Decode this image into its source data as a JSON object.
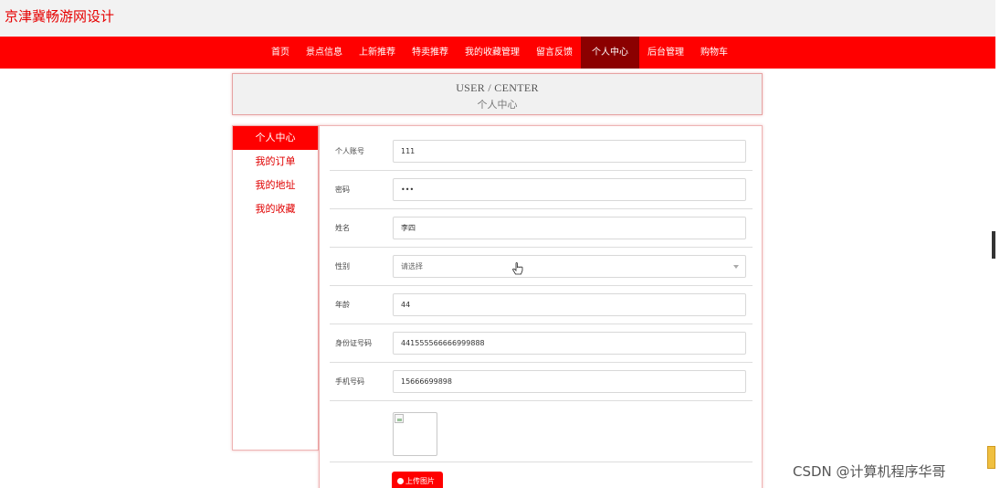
{
  "site": {
    "title": "京津冀畅游网设计"
  },
  "nav": {
    "items": [
      {
        "label": "首页"
      },
      {
        "label": "景点信息"
      },
      {
        "label": "上新推荐"
      },
      {
        "label": "特卖推荐"
      },
      {
        "label": "我的收藏管理"
      },
      {
        "label": "留言反馈"
      },
      {
        "label": "个人中心",
        "active": true
      },
      {
        "label": "后台管理"
      },
      {
        "label": "购物车"
      }
    ]
  },
  "header": {
    "title_en": "USER / CENTER",
    "title_cn": "个人中心"
  },
  "sidebar": {
    "items": [
      {
        "label": "个人中心",
        "active": true
      },
      {
        "label": "我的订单"
      },
      {
        "label": "我的地址"
      },
      {
        "label": "我的收藏"
      }
    ]
  },
  "form": {
    "account": {
      "label": "个人账号",
      "value": "111"
    },
    "password": {
      "label": "密码",
      "value": "•••"
    },
    "name": {
      "label": "姓名",
      "value": "李四"
    },
    "gender": {
      "label": "性别",
      "value": "请选择"
    },
    "age": {
      "label": "年龄",
      "value": "44"
    },
    "id_number": {
      "label": "身份证号码",
      "value": "441555566666999888"
    },
    "phone": {
      "label": "手机号码",
      "value": "15666699898"
    },
    "upload_label": "上传图片"
  },
  "watermark": "CSDN @计算机程序华哥",
  "colors": {
    "primary": "#ff0000",
    "nav_active": "#8b0000",
    "header_bg": "#f2f2f2"
  },
  "icons": {
    "upload": "upload-icon",
    "cursor": "hand-cursor-icon",
    "select": "chevron-down-icon"
  }
}
